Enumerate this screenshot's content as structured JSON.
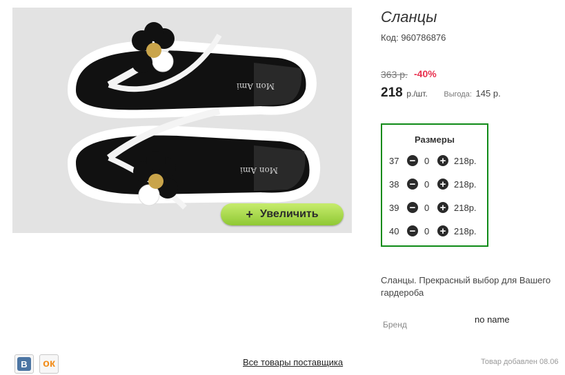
{
  "product": {
    "title": "Сланцы",
    "code": "Код: 960786876",
    "old_price": "363 р.",
    "discount": "-40%",
    "price": "218",
    "price_unit": "р./шт.",
    "savings_label": "Выгода:",
    "savings": "145 р.",
    "description": "Сланцы. Прекрасный выбор для Вашего гардероба",
    "brand_label": "Бренд",
    "brand_value": "no name",
    "added": "Товар добавлен 08.06"
  },
  "image": {
    "zoom_label": "Увеличить",
    "zoom_icon": "+",
    "insole_text": "Mon Ami"
  },
  "sizes": {
    "title": "Размеры",
    "rows": [
      {
        "size": "37",
        "qty": "0",
        "price": "218р."
      },
      {
        "size": "38",
        "qty": "0",
        "price": "218р."
      },
      {
        "size": "39",
        "qty": "0",
        "price": "218р."
      },
      {
        "size": "40",
        "qty": "0",
        "price": "218р."
      }
    ],
    "minus_icon": "−",
    "plus_icon": "+"
  },
  "social": {
    "vk_label": "В",
    "ok_label": "ок"
  },
  "links": {
    "supplier": "Все товары поставщика"
  },
  "colors": {
    "accent_green": "#0e8a16",
    "discount_red": "#e8304e",
    "button_green": "#8fc834"
  }
}
